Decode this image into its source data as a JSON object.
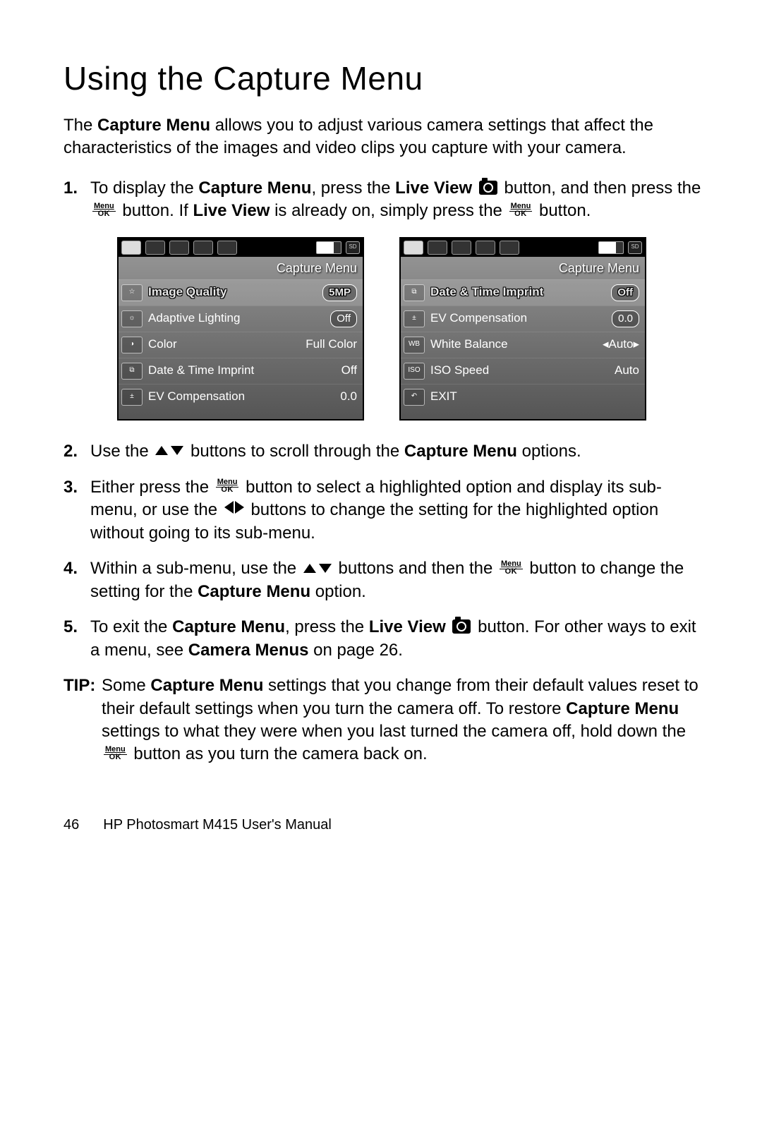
{
  "heading": "Using the Capture Menu",
  "intro_parts": {
    "p1": "The ",
    "b1": "Capture Menu",
    "p2": " allows you to adjust various camera settings that affect the characteristics of the images and video clips you capture with your camera."
  },
  "menuok": {
    "top": "Menu",
    "bot": "OK"
  },
  "steps": {
    "s1": {
      "num": "1.",
      "a": "To display the ",
      "b": "Capture Menu",
      "c": ", press the ",
      "d": "Live View",
      "e": " button, and then press the ",
      "f": " button. If ",
      "g": "Live View",
      "h": " is already on, simply press the ",
      "i": " button."
    },
    "s2": {
      "num": "2.",
      "a": "Use the ",
      "b": " buttons to scroll through the ",
      "c": "Capture Menu",
      "d": " options."
    },
    "s3": {
      "num": "3.",
      "a": "Either press the ",
      "b": " button to select a highlighted option and display its sub-menu, or use the ",
      "c": " buttons to change the setting for the highlighted option without going to its sub-menu."
    },
    "s4": {
      "num": "4.",
      "a": "Within a sub-menu, use the ",
      "b": " buttons and then the ",
      "c": " button to change the setting for the ",
      "d": "Capture Menu",
      "e": " option."
    },
    "s5": {
      "num": "5.",
      "a": "To exit the ",
      "b": "Capture Menu",
      "c": ", press the ",
      "d": "Live View",
      "e": " button. For other ways to exit a menu, see ",
      "f": "Camera Menus",
      "g": " on page 26."
    }
  },
  "screens": {
    "title": "Capture Menu",
    "left": {
      "rows": [
        {
          "icon": "☆",
          "name": "Image Quality",
          "val": "5MP",
          "badge": true,
          "sel": true
        },
        {
          "icon": "☼",
          "name": "Adaptive Lighting",
          "val": "Off",
          "badge": true
        },
        {
          "icon": "◑",
          "name": "Color",
          "val": "Full Color"
        },
        {
          "icon": "⧉",
          "name": "Date & Time Imprint",
          "val": "Off"
        },
        {
          "icon": "±",
          "name": "EV Compensation",
          "val": "0.0"
        }
      ]
    },
    "right": {
      "rows": [
        {
          "icon": "⧉",
          "name": "Date & Time Imprint",
          "val": "Off",
          "badge": true,
          "sel": true
        },
        {
          "icon": "±",
          "name": "EV Compensation",
          "val": "0.0",
          "badge": true
        },
        {
          "icon": "WB",
          "name": "White Balance",
          "val": "◂Auto▸"
        },
        {
          "icon": "ISO",
          "name": "ISO Speed",
          "val": "Auto"
        },
        {
          "icon": "↶",
          "name": "EXIT",
          "val": ""
        }
      ]
    }
  },
  "tip": {
    "label": "TIP:",
    "a": "Some ",
    "b": "Capture Menu",
    "c": " settings that you change from their default values reset to their default settings when you turn the camera off. To restore ",
    "d": "Capture Menu",
    "e": " settings to what they were when you last turned the camera off, hold down the ",
    "f": " button as you turn the camera back on."
  },
  "footer": {
    "page": "46",
    "title": "HP Photosmart M415 User's Manual"
  }
}
